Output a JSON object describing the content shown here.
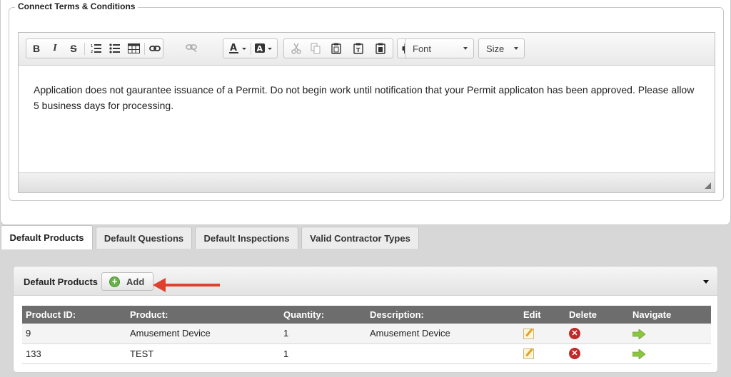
{
  "terms": {
    "legend": "Connect Terms & Conditions",
    "toolbar": {
      "bold": "B",
      "italic": "I",
      "strike": "S",
      "font_label": "Font",
      "size_label": "Size"
    },
    "content": "Application does not gaurantee issuance of a Permit. Do not begin work until notification that your Permit applicaton has been approved. Please allow 5 business days for processing."
  },
  "tabs": [
    {
      "label": "Default Products",
      "active": true
    },
    {
      "label": "Default Questions",
      "active": false
    },
    {
      "label": "Default Inspections",
      "active": false
    },
    {
      "label": "Valid Contractor Types",
      "active": false
    }
  ],
  "products": {
    "title": "Default Products",
    "add_label": "Add",
    "columns": [
      "Product ID:",
      "Product:",
      "Quantity:",
      "Description:",
      "Edit",
      "Delete",
      "Navigate"
    ],
    "rows": [
      {
        "id": "9",
        "product": "Amusement Device",
        "quantity": "1",
        "description": "Amusement Device"
      },
      {
        "id": "133",
        "product": "TEST",
        "quantity": "1",
        "description": ""
      }
    ]
  },
  "colors": {
    "annotation_arrow": "#e0402e",
    "add_icon": "#69b24a",
    "delete_icon": "#c02a2a",
    "navigate_icon": "#8cc63f",
    "table_header": "#6d6d6d"
  },
  "icons": [
    "bold-icon",
    "italic-icon",
    "strikethrough-icon",
    "numbered-list-icon",
    "bulleted-list-icon",
    "table-icon",
    "link-icon",
    "unlink-icon",
    "text-color-icon",
    "background-color-icon",
    "cut-icon",
    "copy-icon",
    "paste-icon",
    "paste-text-icon",
    "paste-word-icon",
    "print-icon",
    "plus-icon",
    "edit-icon",
    "delete-icon",
    "navigate-arrow-icon"
  ]
}
